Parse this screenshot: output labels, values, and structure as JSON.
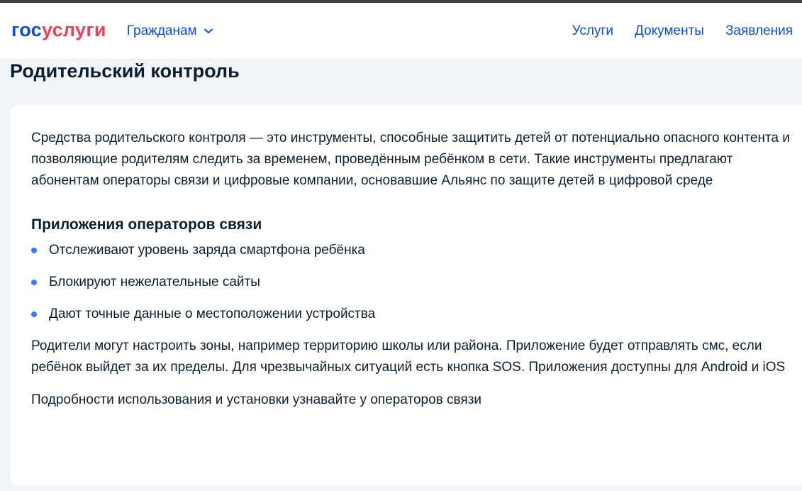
{
  "header": {
    "logo_part1": "гос",
    "logo_part2": "услуги",
    "dropdown_label": "Гражданам",
    "nav": [
      "Услуги",
      "Документы",
      "Заявления"
    ]
  },
  "page": {
    "title": "Родительский контроль"
  },
  "content": {
    "intro": "Средства родительского контроля — это инструменты, способные защитить детей от потенциально опасного контента и позволяющие родителям следить за временем, проведённым ребёнком в сети. Такие инструменты предлагают абонентам операторы связи и цифровые компании, основавшие Альянс по защите детей в цифровой среде",
    "section_title": "Приложения операторов связи",
    "bullets": [
      "Отслеживают уровень заряда смартфона ребёнка",
      "Блокируют нежелательные сайты",
      "Дают точные данные о местоположении устройства"
    ],
    "paragraph2": "Родители могут настроить зоны, например территорию школы или района. Приложение будет отправлять смс, если ребёнок выйдет за их пределы. Для чрезвычайных ситуаций есть кнопка SOS. Приложения доступны для Android и iOS",
    "paragraph3": "Подробности использования и установки узнавайте у операторов связи"
  },
  "colors": {
    "brand_blue": "#0d4cd3",
    "brand_red": "#ee3f58",
    "bullet": "#3a79f6",
    "background": "#f2f4f8"
  }
}
